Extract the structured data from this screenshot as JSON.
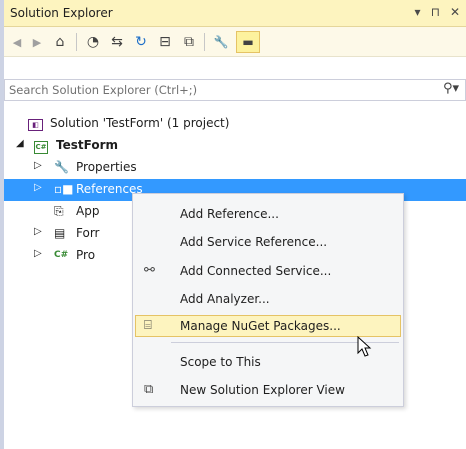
{
  "window": {
    "title": "Solution Explorer",
    "title_controls": [
      "▾",
      "⊓",
      "✕"
    ]
  },
  "toolbar": {
    "items": [
      {
        "icon": "back-icon",
        "glyph": "◀"
      },
      {
        "icon": "forward-icon",
        "glyph": "▶"
      },
      {
        "icon": "home-icon",
        "glyph": "⌂"
      },
      {
        "icon": "pending-changes-filter-icon",
        "glyph": "◔"
      },
      {
        "icon": "sync-with-active-document-icon",
        "glyph": "⇆"
      },
      {
        "icon": "refresh-icon",
        "glyph": "↻"
      },
      {
        "icon": "collapse-all-icon",
        "glyph": "⊟"
      },
      {
        "icon": "show-all-files-icon",
        "glyph": "⧉"
      },
      {
        "icon": "properties-icon",
        "glyph": "🔧"
      },
      {
        "icon": "preview-selected-items-icon",
        "glyph": "▬"
      }
    ]
  },
  "search": {
    "placeholder": "Search Solution Explorer (Ctrl+;)",
    "icon": "search-icon"
  },
  "tree": {
    "solution": "Solution 'TestForm' (1 project)",
    "project": "TestForm",
    "project_badge": "C#",
    "items": {
      "properties": "Properties",
      "references": "References",
      "app": "App",
      "form": "Forr",
      "program": "Pro",
      "program_badge": "C#"
    }
  },
  "context_menu": {
    "add_reference": "Add Reference...",
    "add_service_reference": "Add Service Reference...",
    "add_connected_service": "Add Connected Service...",
    "add_analyzer": "Add Analyzer...",
    "manage_nuget": "Manage NuGet Packages...",
    "scope_to_this": "Scope to This",
    "new_view": "New Solution Explorer View",
    "hovered_item": "Manage NuGet Packages..."
  }
}
